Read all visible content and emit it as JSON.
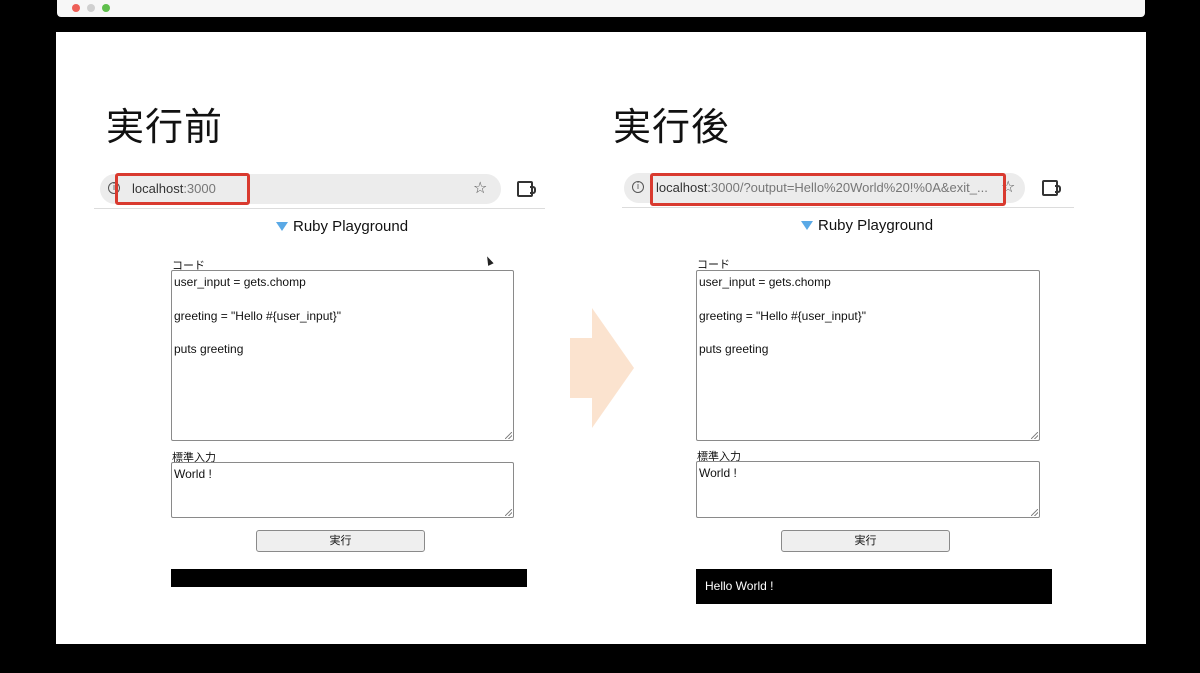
{
  "window": {
    "controls": [
      "close",
      "minimize",
      "maximize"
    ]
  },
  "before": {
    "heading": "実行前",
    "url_host": "localhost",
    "url_rest": ":3000",
    "page_title": "Ruby Playground",
    "code_label": "コード",
    "code_value": "user_input = gets.chomp\n\ngreeting = \"Hello #{user_input}\"\n\nputs greeting",
    "stdin_label": "標準入力",
    "stdin_value": "World !",
    "run_label": "実行",
    "output": ""
  },
  "after": {
    "heading": "実行後",
    "url_host": "localhost",
    "url_rest": ":3000/?output=Hello%20World%20!%0A&exit_...",
    "page_title": "Ruby Playground",
    "code_label": "コード",
    "code_value": "user_input = gets.chomp\n\ngreeting = \"Hello #{user_input}\"\n\nputs greeting",
    "stdin_label": "標準入力",
    "stdin_value": "World !",
    "run_label": "実行",
    "output": "Hello World !"
  },
  "icons": {
    "site_info": "info-icon",
    "bookmark": "star-icon",
    "extensions": "puzzle-icon",
    "logo": "gem-icon",
    "transition": "right-arrow-icon"
  },
  "colors": {
    "highlight": "#d93a2f",
    "arrow": "#fbe3cf",
    "gem": "#5aa9e6",
    "output_bg": "#000000",
    "output_text": "#ffffff"
  }
}
